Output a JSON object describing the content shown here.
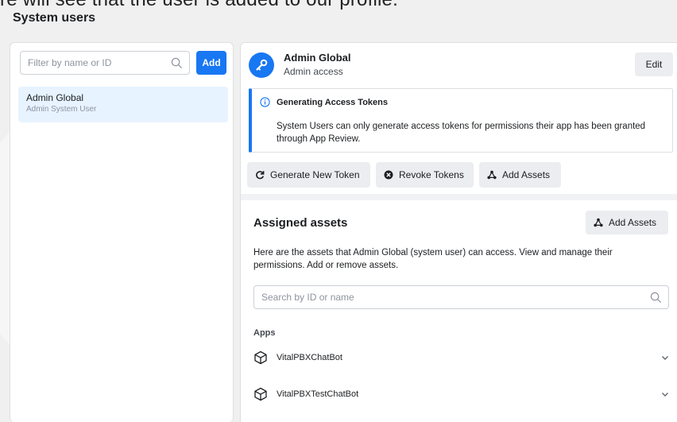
{
  "caption_fragment": "re will see that the user is added to our profile.",
  "page_title": "System users",
  "left_panel": {
    "filter_placeholder": "Filter by name or ID",
    "add_label": "Add",
    "users": [
      {
        "name": "Admin Global",
        "role": "Admin System User"
      }
    ]
  },
  "detail": {
    "name": "Admin Global",
    "subtitle": "Admin access",
    "edit_label": "Edit",
    "notice": {
      "title": "Generating Access Tokens",
      "body": "System Users can only generate access tokens for permissions their app has been granted through App Review."
    },
    "actions": {
      "generate": "Generate New Token",
      "revoke": "Revoke Tokens",
      "add_assets": "Add Assets"
    }
  },
  "assigned": {
    "title": "Assigned assets",
    "add_assets_label": "Add Assets",
    "description": "Here are the assets that Admin Global (system user) can access. View and manage their permissions. Add or remove assets.",
    "search_placeholder": "Search by ID or name",
    "apps_label": "Apps",
    "apps": [
      {
        "name": "VitalPBXChatBot"
      },
      {
        "name": "VitalPBXTestChatBot"
      }
    ]
  },
  "colors": {
    "accent": "#1877f2",
    "selected_bg": "#e7f3ff",
    "button_bg": "#ebedf0"
  },
  "icons": [
    "search-icon",
    "key-icon",
    "info-icon",
    "refresh-icon",
    "revoke-icon",
    "assets-icon",
    "app-cube-icon",
    "chevron-down-icon"
  ]
}
